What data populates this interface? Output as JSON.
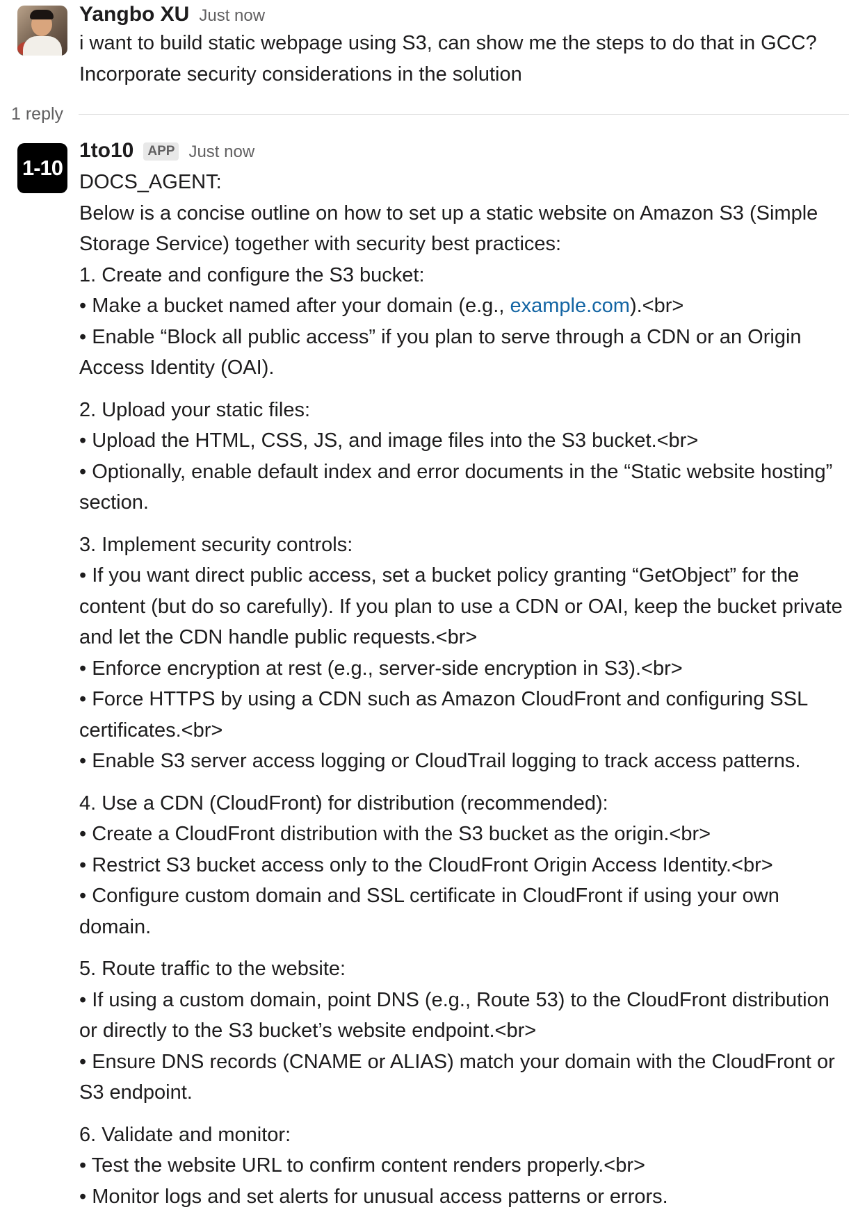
{
  "user_message": {
    "author": "Yangbo XU",
    "time": "Just now",
    "lines": [
      "i want to build static webpage using S3, can show me the steps to do that in GCC?",
      "Incorporate security considerations in the solution"
    ]
  },
  "thread": {
    "reply_count": "1 reply"
  },
  "bot_message": {
    "avatar_text": "1-10",
    "author": "1to10",
    "badge": "APP",
    "time": "Just now",
    "agent_label": "DOCS_AGENT:",
    "intro": "Below is a concise outline on how to set up a static website on Amazon S3 (Simple Storage Service) together with security best practices:",
    "step1": {
      "title": "1. Create and configure the S3 bucket:",
      "b1_pre": "• Make a bucket named after your domain (e.g., ",
      "b1_link": "example.com",
      "b1_post": ").<br>",
      "b2": "• Enable “Block all public access” if you plan to serve through a CDN or an Origin Access Identity (OAI)."
    },
    "step2": {
      "title": "2. Upload your static files:",
      "b1": "• Upload the HTML, CSS, JS, and image files into the S3 bucket.<br>",
      "b2": "• Optionally, enable default index and error documents in the “Static website hosting” section."
    },
    "step3": {
      "title": "3. Implement security controls:",
      "b1": "• If you want direct public access, set a bucket policy granting “GetObject” for the content (but do so carefully). If you plan to use a CDN or OAI, keep the bucket private and let the CDN handle public requests.<br>",
      "b2": "• Enforce encryption at rest (e.g., server-side encryption in S3).<br>",
      "b3": "• Force HTTPS by using a CDN such as Amazon CloudFront and configuring SSL certificates.<br>",
      "b4": "• Enable S3 server access logging or CloudTrail logging to track access patterns."
    },
    "step4": {
      "title": "4. Use a CDN (CloudFront) for distribution (recommended):",
      "b1": "• Create a CloudFront distribution with the S3 bucket as the origin.<br>",
      "b2": "• Restrict S3 bucket access only to the CloudFront Origin Access Identity.<br>",
      "b3": "• Configure custom domain and SSL certificate in CloudFront if using your own domain."
    },
    "step5": {
      "title": "5. Route traffic to the website:",
      "b1": "• If using a custom domain, point DNS (e.g., Route 53) to the CloudFront distribution or directly to the S3 bucket’s website endpoint.<br>",
      "b2": "• Ensure DNS records (CNAME or ALIAS) match your domain with the CloudFront or S3 endpoint."
    },
    "step6": {
      "title": "6. Validate and monitor:",
      "b1": "• Test the website URL to confirm content renders properly.<br>",
      "b2": "• Monitor logs and set alerts for unusual access patterns or errors."
    }
  }
}
